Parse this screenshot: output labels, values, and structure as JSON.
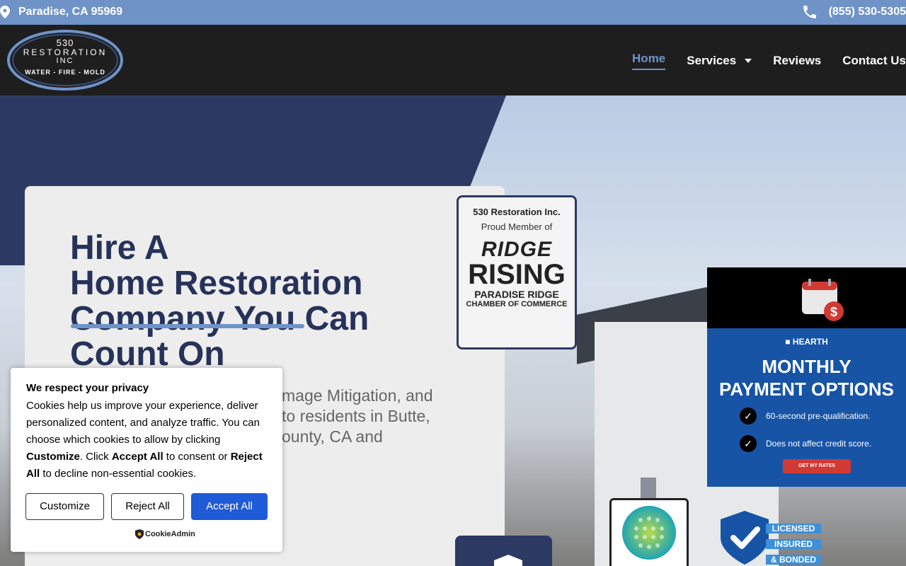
{
  "topbar": {
    "location": "Paradise, CA 95969",
    "phone": "(855) 530-5305"
  },
  "logo": {
    "line1": "530",
    "line2": "RESTORATION",
    "line3": "INC",
    "line4": "WATER - FIRE - MOLD"
  },
  "nav": {
    "items": [
      "Home",
      "Services",
      "Reviews",
      "Contact Us"
    ]
  },
  "hero": {
    "headline": [
      "Hire A",
      "Home Restoration",
      "Company You Can",
      "Count On"
    ],
    "subtext_lines": [
      "mage Mitigation, and",
      "to residents in Butte,",
      "ounty, CA and"
    ]
  },
  "chamber": {
    "t1": "530 Restoration Inc.",
    "t2": "Proud Member of",
    "ridge": "RIDGE",
    "rising": "RISING",
    "t3": "PARADISE RIDGE",
    "t4": "CHAMBER OF COMMERCE"
  },
  "hearth": {
    "brand": "HEARTH",
    "title_line1": "MONTHLY",
    "title_line2": "PAYMENT OPTIONS",
    "bullet1": "60-second pre-qualification.",
    "bullet2": "Does not affect credit score.",
    "cta": "GET MY RATES"
  },
  "badges": {
    "licensed_line1": "LICENSED",
    "licensed_line2": "INSURED",
    "licensed_line3": "& BONDED"
  },
  "cookie": {
    "title": "We respect your privacy",
    "body_before_customize": "Cookies help us improve your experience, deliver personalized content, and analyze traffic. You can choose which cookies to allow by clicking ",
    "customize_bold": "Customize",
    "body_mid1": ". Click ",
    "accept_bold": "Accept All",
    "body_mid2": " to consent or ",
    "reject_bold": "Reject All",
    "body_end": " to decline non-essential cookies.",
    "btn_customize": "Customize",
    "btn_reject": "Reject All",
    "btn_accept": "Accept All",
    "powered": "CookieAdmin"
  },
  "colors": {
    "topbar": "#6f93c7",
    "header": "#1e1e1f",
    "navy": "#2c3a63",
    "hearth_blue": "#1754a6",
    "accept_blue": "#1f5bd6"
  }
}
